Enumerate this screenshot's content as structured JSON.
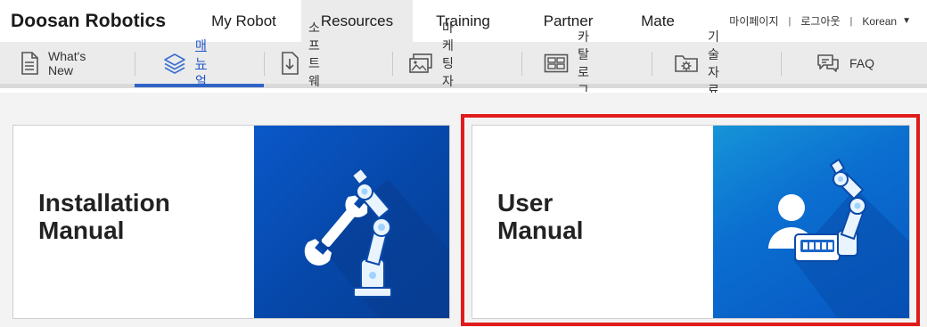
{
  "header": {
    "brand": "Doosan Robotics",
    "nav": [
      {
        "label": "My Robot",
        "active": false
      },
      {
        "label": "Resources",
        "active": true
      },
      {
        "label": "Training",
        "active": false
      },
      {
        "label": "Partner",
        "active": false
      },
      {
        "label": "Mate",
        "active": false
      }
    ],
    "util": {
      "mypage": "마이페이지",
      "logout": "로그아웃",
      "language": "Korean",
      "separator": "|"
    }
  },
  "subnav": {
    "items": [
      {
        "label": "What's New",
        "icon": "document-icon",
        "active": false
      },
      {
        "label": "매뉴얼",
        "icon": "layers-icon",
        "active": true
      },
      {
        "label": "소프트웨어",
        "icon": "download-icon",
        "active": false
      },
      {
        "label": "마케팅 자료",
        "icon": "images-icon",
        "active": false
      },
      {
        "label": "카탈로그",
        "icon": "catalog-icon",
        "active": false
      },
      {
        "label": "기술자료",
        "icon": "folder-gear-icon",
        "active": false
      },
      {
        "label": "FAQ",
        "icon": "chat-icon",
        "active": false
      }
    ]
  },
  "cards": [
    {
      "title_line1": "Installation",
      "title_line2": "Manual",
      "icon": "robot-arm-wrench-icon",
      "selected": false
    },
    {
      "title_line1": "User",
      "title_line2": "Manual",
      "icon": "robot-arm-user-icon",
      "selected": true
    }
  ],
  "colors": {
    "accent_blue": "#2f63c8",
    "card_blue": "#0647a8",
    "card_blue_light": "#1694d8",
    "highlight_red": "#e11b1b",
    "nav_active_bg": "#ebebeb"
  }
}
